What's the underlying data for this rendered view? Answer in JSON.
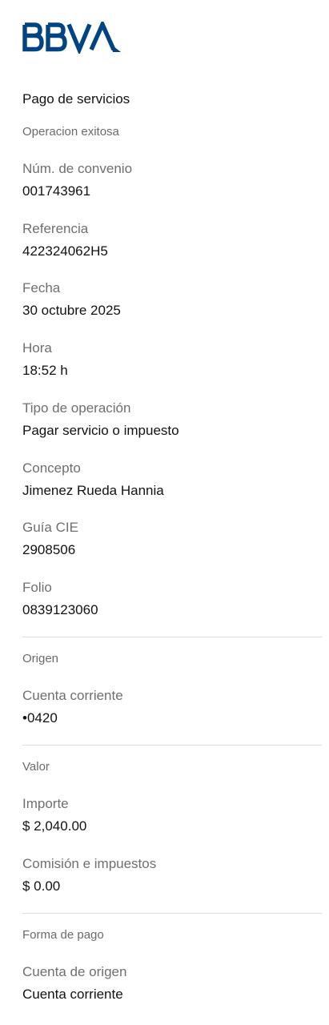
{
  "brand": {
    "logo_text": "BBVA",
    "logo_color": "#004481"
  },
  "header": {
    "title": "Pago de servicios",
    "status": "Operacion exitosa"
  },
  "details": [
    {
      "label": "Núm. de convenio",
      "value": "001743961"
    },
    {
      "label": "Referencia",
      "value": "422324062H5"
    },
    {
      "label": "Fecha",
      "value": "30 octubre 2025"
    },
    {
      "label": "Hora",
      "value": "18:52 h"
    },
    {
      "label": "Tipo de operación",
      "value": "Pagar servicio o impuesto"
    },
    {
      "label": "Concepto",
      "value": "Jimenez Rueda Hannia"
    },
    {
      "label": "Guía CIE",
      "value": "2908506"
    },
    {
      "label": "Folio",
      "value": "0839123060"
    }
  ],
  "origen": {
    "section_title": "Origen",
    "fields": [
      {
        "label": "Cuenta corriente",
        "value": "•0420"
      }
    ]
  },
  "valor": {
    "section_title": "Valor",
    "fields": [
      {
        "label": "Importe",
        "value": "$ 2,040.00"
      },
      {
        "label": "Comisión e impuestos",
        "value": "$ 0.00"
      }
    ]
  },
  "forma_pago": {
    "section_title": "Forma de pago",
    "fields": [
      {
        "label": "Cuenta de origen",
        "value": "Cuenta corriente"
      }
    ]
  }
}
